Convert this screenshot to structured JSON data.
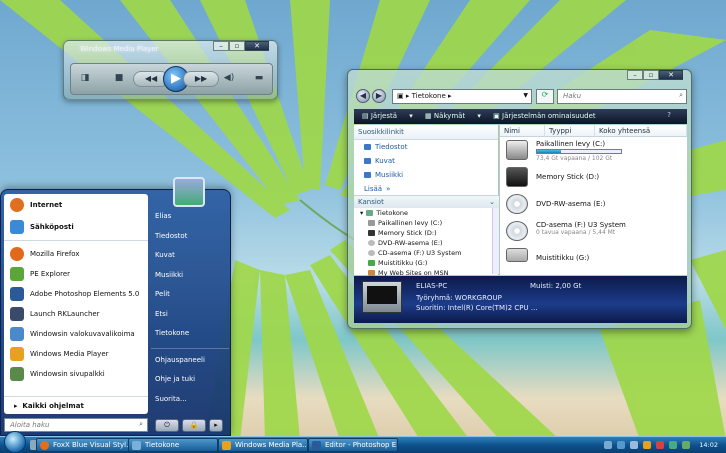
{
  "wmp": {
    "title": "Windows Media Player"
  },
  "explorer": {
    "address": "Tietokone",
    "search_placeholder": "Haku",
    "toolbar": {
      "organize": "Järjestä",
      "views": "Näkymät",
      "properties": "Järjestelmän ominaisuudet"
    },
    "favorites_header": "Suosikkilinkit",
    "favorites": [
      "Tiedostot",
      "Kuvat",
      "Musiikki"
    ],
    "favorites_more": "Lisää",
    "folders_header": "Kansiot",
    "tree": [
      "Tietokone",
      "Paikallinen levy (C:)",
      "Memory Stick (D:)",
      "DVD-RW-asema (E:)",
      "CD-asema (F:) U3 System",
      "Muistitikku (G:)",
      "My Web Sites on MSN"
    ],
    "columns": [
      "Nimi",
      "Tyyppi",
      "Koko yhteensä"
    ],
    "drives": [
      {
        "name": "Paikallinen levy (C:)",
        "sub": "73,4 Gt vapaana / 102 Gt",
        "used": 0.28
      },
      {
        "name": "Memory Stick (D:)",
        "sub": ""
      },
      {
        "name": "DVD-RW-asema (E:)",
        "sub": ""
      },
      {
        "name": "CD-asema (F:) U3 System",
        "sub": "0 tavua vapaana / 5,44 Mt"
      },
      {
        "name": "Muistitikku (G:)",
        "sub": ""
      }
    ],
    "details": {
      "pc_name": "ELIAS-PC",
      "memory": "Muisti: 2,00 Gt",
      "workgroup": "Työryhmä: WORKGROUP",
      "cpu": "Suoritin: Intel(R) Core(TM)2 CPU ..."
    }
  },
  "startmenu": {
    "pinned": [
      {
        "label": "Internet",
        "color": "#e07020"
      },
      {
        "label": "Sähköposti",
        "color": "#3a8ad8"
      }
    ],
    "recent": [
      {
        "label": "Mozilla Firefox",
        "color": "#e06a1a"
      },
      {
        "label": "PE Explorer",
        "color": "#5aa63a"
      },
      {
        "label": "Adobe Photoshop Elements 5.0",
        "color": "#2a5a9a"
      },
      {
        "label": "Launch RKLauncher",
        "color": "#3a4a6a"
      },
      {
        "label": "Windowsin valokuvavalikoima",
        "color": "#4a8ac8"
      },
      {
        "label": "Windows Media Player",
        "color": "#e8a020"
      },
      {
        "label": "Windowsin sivupalkki",
        "color": "#5a8a4a"
      }
    ],
    "all_programs": "Kaikki ohjelmat",
    "search_placeholder": "Aloita haku",
    "right": [
      "Elias",
      "Tiedostot",
      "Kuvat",
      "Musiikki",
      "Pelit",
      "Etsi",
      "Tietokone",
      "Ohjauspaneeli",
      "Ohje ja tuki",
      "Suorita..."
    ]
  },
  "taskbar": {
    "buttons": [
      {
        "label": "FoxX Blue Visual Styl...",
        "color": "#e07020"
      },
      {
        "label": "Tietokone",
        "color": "#7ab0d8"
      },
      {
        "label": "Windows Media Pla...",
        "color": "#e8a020"
      },
      {
        "label": "Editor - Photoshop E...",
        "color": "#2a5a9a"
      }
    ],
    "clock": "14:02"
  }
}
